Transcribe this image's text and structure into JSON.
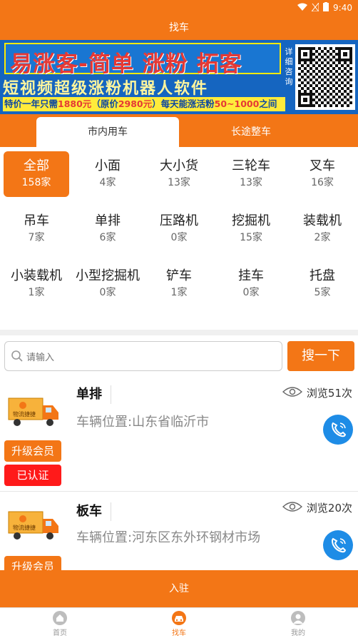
{
  "status": {
    "time": "9:40"
  },
  "header": {
    "title": "找车"
  },
  "banner": {
    "line1": "易涨客-简单 涨粉 拓客",
    "line2": "短视频超级涨粉机器人软件",
    "line3_a": "特价一年只需",
    "line3_price": "1880元",
    "line3_b": "（原价",
    "line3_orig": "2980元",
    "line3_c": "）每天能涨活粉",
    "line3_range": "50~1000",
    "line3_d": "之间",
    "side": [
      "详",
      "细",
      "咨",
      "询"
    ]
  },
  "tabs": [
    {
      "label": "市内用车",
      "active": true
    },
    {
      "label": "长途整车",
      "active": false
    }
  ],
  "categories": [
    {
      "name": "全部",
      "count": "158家",
      "active": true
    },
    {
      "name": "小面",
      "count": "4家"
    },
    {
      "name": "大小货",
      "count": "13家"
    },
    {
      "name": "三轮车",
      "count": "13家"
    },
    {
      "name": "叉车",
      "count": "16家"
    },
    {
      "name": "吊车",
      "count": "7家"
    },
    {
      "name": "单排",
      "count": "6家"
    },
    {
      "name": "压路机",
      "count": "0家"
    },
    {
      "name": "挖掘机",
      "count": "15家"
    },
    {
      "name": "装载机",
      "count": "2家"
    },
    {
      "name": "小装载机",
      "count": "1家"
    },
    {
      "name": "小型挖掘机",
      "count": "0家"
    },
    {
      "name": "铲车",
      "count": "1家"
    },
    {
      "name": "挂车",
      "count": "0家"
    },
    {
      "name": "托盘",
      "count": "5家"
    }
  ],
  "search": {
    "placeholder": "请输入",
    "button": "搜一下"
  },
  "listings": [
    {
      "title": "单排",
      "location": "车辆位置:山东省临沂市",
      "views": "浏览51次",
      "upgrade": "升级会员",
      "verified": "已认证",
      "truck_label": "物流捷捷"
    },
    {
      "title": "板车",
      "location": "车辆位置:河东区东外环钢材市场",
      "views": "浏览20次",
      "upgrade": "升级会员",
      "truck_label": "物流捷捷"
    }
  ],
  "join_label": "入驻",
  "bottom_nav": [
    {
      "label": "首页",
      "icon": "home-icon"
    },
    {
      "label": "找车",
      "icon": "car-icon",
      "active": true
    },
    {
      "label": "我的",
      "icon": "user-icon"
    }
  ],
  "colors": {
    "primary": "#f37616",
    "call": "#1e8ce6",
    "verified": "#ff1a1a"
  }
}
